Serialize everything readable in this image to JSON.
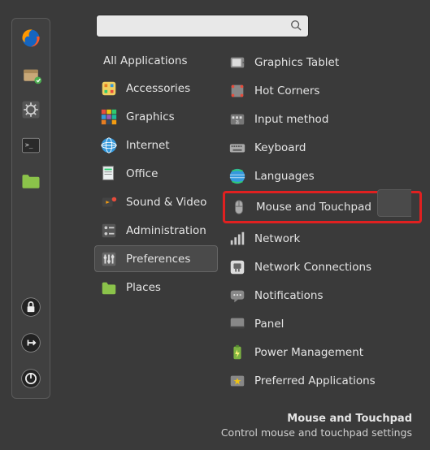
{
  "search": {
    "value": "",
    "placeholder": ""
  },
  "categories": {
    "all_label": "All Applications",
    "items": [
      {
        "label": "Accessories"
      },
      {
        "label": "Graphics"
      },
      {
        "label": "Internet"
      },
      {
        "label": "Office"
      },
      {
        "label": "Sound & Video"
      },
      {
        "label": "Administration"
      },
      {
        "label": "Preferences",
        "selected": true
      },
      {
        "label": "Places"
      }
    ]
  },
  "apps": {
    "items": [
      {
        "label": "Graphics Tablet"
      },
      {
        "label": "Hot Corners"
      },
      {
        "label": "Input method"
      },
      {
        "label": "Keyboard"
      },
      {
        "label": "Languages"
      },
      {
        "label": "Mouse and Touchpad",
        "highlighted": true
      },
      {
        "label": "Network"
      },
      {
        "label": "Network Connections"
      },
      {
        "label": "Notifications"
      },
      {
        "label": "Panel"
      },
      {
        "label": "Power Management"
      },
      {
        "label": "Preferred Applications"
      }
    ]
  },
  "footer": {
    "title": "Mouse and Touchpad",
    "desc": "Control mouse and touchpad settings"
  }
}
